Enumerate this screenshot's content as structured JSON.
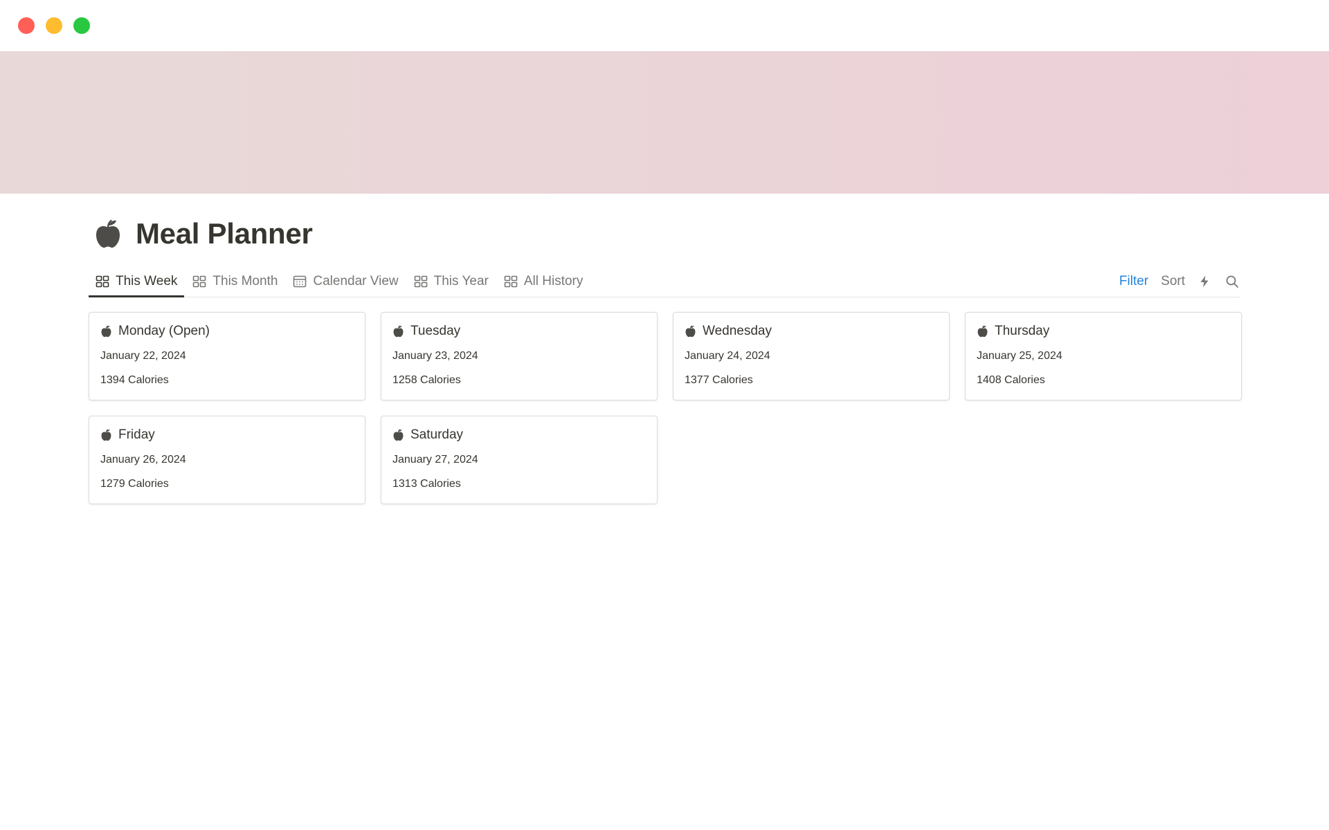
{
  "window": {
    "controls": [
      {
        "name": "close",
        "color": "#ff5f57"
      },
      {
        "name": "minimize",
        "color": "#febc2e"
      },
      {
        "name": "zoom",
        "color": "#28c840"
      }
    ]
  },
  "page": {
    "icon": "apple-icon",
    "title": "Meal Planner"
  },
  "tabs": [
    {
      "label": "This Week",
      "icon": "gallery-icon",
      "active": true
    },
    {
      "label": "This Month",
      "icon": "gallery-icon",
      "active": false
    },
    {
      "label": "Calendar View",
      "icon": "calendar-icon",
      "active": false
    },
    {
      "label": "This Year",
      "icon": "gallery-icon",
      "active": false
    },
    {
      "label": "All History",
      "icon": "gallery-icon",
      "active": false
    }
  ],
  "actions": {
    "filter_label": "Filter",
    "sort_label": "Sort",
    "automation_icon": "lightning-icon",
    "search_icon": "search-icon"
  },
  "cards": [
    {
      "title": "Monday (Open)",
      "date": "January 22, 2024",
      "calories": "1394 Calories"
    },
    {
      "title": "Tuesday",
      "date": "January 23, 2024",
      "calories": "1258 Calories"
    },
    {
      "title": "Wednesday",
      "date": "January 24, 2024",
      "calories": "1377 Calories"
    },
    {
      "title": "Thursday",
      "date": "January 25, 2024",
      "calories": "1408 Calories"
    },
    {
      "title": "Friday",
      "date": "January 26, 2024",
      "calories": "1279 Calories"
    },
    {
      "title": "Saturday",
      "date": "January 27, 2024",
      "calories": "1313 Calories"
    }
  ],
  "colors": {
    "text": "#37352f",
    "muted": "#787774",
    "accent": "#2383e2",
    "cover_start": "#e8d9d8",
    "cover_end": "#edd0d8"
  }
}
